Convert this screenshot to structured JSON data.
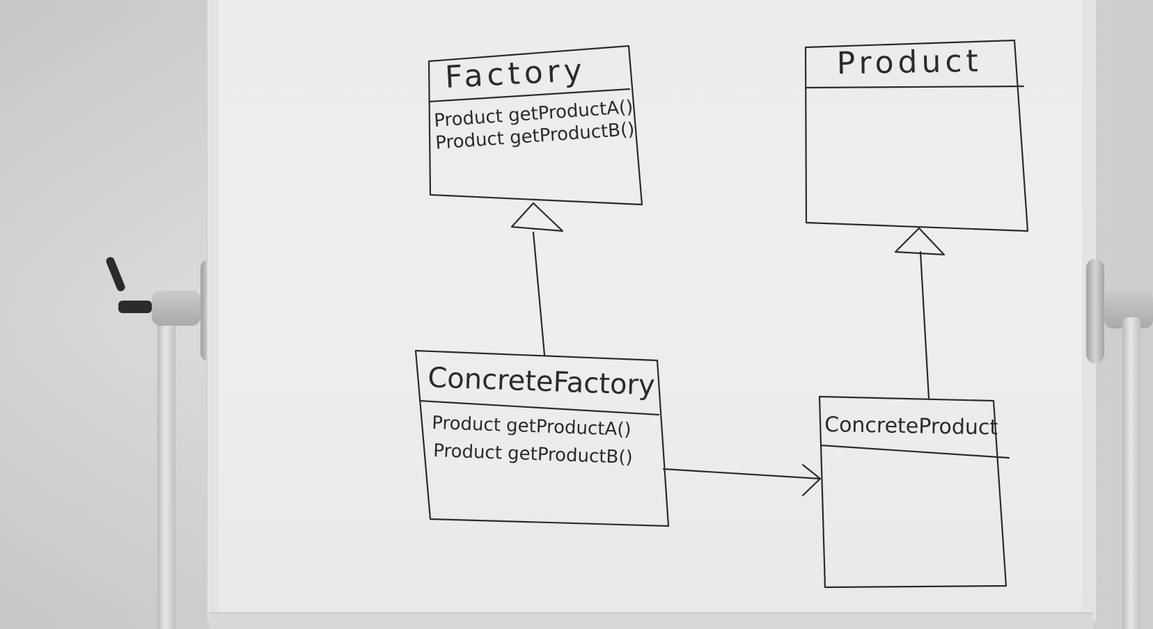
{
  "diagram": {
    "factory": {
      "name": "Factory",
      "methods": [
        "Product getProductA()",
        "Product getProductB()"
      ]
    },
    "product": {
      "name": "Product",
      "methods": []
    },
    "concrete_factory": {
      "name": "ConcreteFactory",
      "methods": [
        "Product getProductA()",
        "Product getProductB()"
      ]
    },
    "concrete_product": {
      "name": "ConcreteProduct",
      "methods": []
    },
    "relations": [
      {
        "type": "inheritance",
        "from": "ConcreteFactory",
        "to": "Factory"
      },
      {
        "type": "inheritance",
        "from": "ConcreteProduct",
        "to": "Product"
      },
      {
        "type": "association",
        "from": "ConcreteFactory",
        "to": "ConcreteProduct"
      }
    ]
  },
  "colors": {
    "ink": "#2b2b2b",
    "board": "#ededeb",
    "wall": "#d6d7d4"
  }
}
